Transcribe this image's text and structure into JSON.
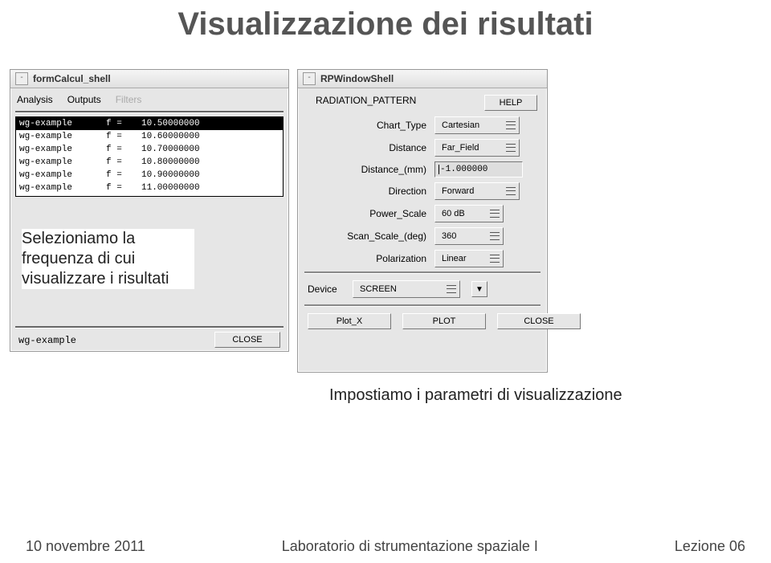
{
  "slide": {
    "title": "Visualizzazione dei risultati"
  },
  "formcalcul": {
    "window_title": "formCalcul_shell",
    "menu": {
      "analysis": "Analysis",
      "outputs": "Outputs",
      "filters": "Filters"
    },
    "rows": [
      {
        "name": "wg-example",
        "f": "f =",
        "val": "10.50000000",
        "selected": true
      },
      {
        "name": "wg-example",
        "f": "f =",
        "val": "10.60000000",
        "selected": false
      },
      {
        "name": "wg-example",
        "f": "f =",
        "val": "10.70000000",
        "selected": false
      },
      {
        "name": "wg-example",
        "f": "f =",
        "val": "10.80000000",
        "selected": false
      },
      {
        "name": "wg-example",
        "f": "f =",
        "val": "10.90000000",
        "selected": false
      },
      {
        "name": "wg-example",
        "f": "f =",
        "val": "11.00000000",
        "selected": false
      }
    ],
    "status": "wg-example",
    "close": "CLOSE"
  },
  "rpwin": {
    "window_title": "RPWindowShell",
    "header": "RADIATION_PATTERN",
    "help": "HELP",
    "fields": {
      "chart_type": {
        "label": "Chart_Type",
        "value": "Cartesian"
      },
      "distance": {
        "label": "Distance",
        "value": "Far_Field"
      },
      "distance_mm": {
        "label": "Distance_(mm)",
        "value": "-1.000000"
      },
      "direction": {
        "label": "Direction",
        "value": "Forward"
      },
      "power_scale": {
        "label": "Power_Scale",
        "value": "60 dB"
      },
      "scan_scale": {
        "label": "Scan_Scale_(deg)",
        "value": "360"
      },
      "polarization": {
        "label": "Polarization",
        "value": "Linear"
      }
    },
    "device_label": "Device",
    "device_value": "SCREEN",
    "buttons": {
      "plot_x": "Plot_X",
      "plot": "PLOT",
      "close": "CLOSE"
    }
  },
  "callouts": {
    "left": "Selezioniamo la frequenza di cui visualizzare i risultati",
    "right": "Impostiamo i parametri di visualizzazione"
  },
  "footer": {
    "date": "10 novembre 2011",
    "center": "Laboratorio di strumentazione spaziale I",
    "right": "Lezione 06"
  }
}
